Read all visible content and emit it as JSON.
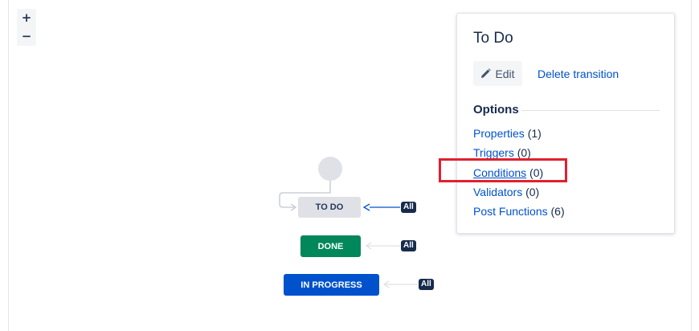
{
  "zoom": {
    "in_label": "+",
    "out_label": "−"
  },
  "workflow": {
    "statuses": [
      {
        "name": "TO DO",
        "color": "#dfe1e6",
        "text_color": "#253858"
      },
      {
        "name": "DONE",
        "color": "#00875a",
        "text_color": "#ffffff"
      },
      {
        "name": "IN PROGRESS",
        "color": "#0052cc",
        "text_color": "#ffffff"
      }
    ],
    "all_badge": "All"
  },
  "panel": {
    "title": "To Do",
    "edit_label": "Edit",
    "delete_label": "Delete transition",
    "options_heading": "Options",
    "options": [
      {
        "label": "Properties",
        "count": "(1)"
      },
      {
        "label": "Triggers",
        "count": "(0)"
      },
      {
        "label": "Conditions",
        "count": "(0)",
        "highlighted": true
      },
      {
        "label": "Validators",
        "count": "(0)"
      },
      {
        "label": "Post Functions",
        "count": "(6)"
      }
    ]
  },
  "colors": {
    "link": "#0052cc",
    "highlight": "#e0202f",
    "badge": "#172b4d"
  }
}
